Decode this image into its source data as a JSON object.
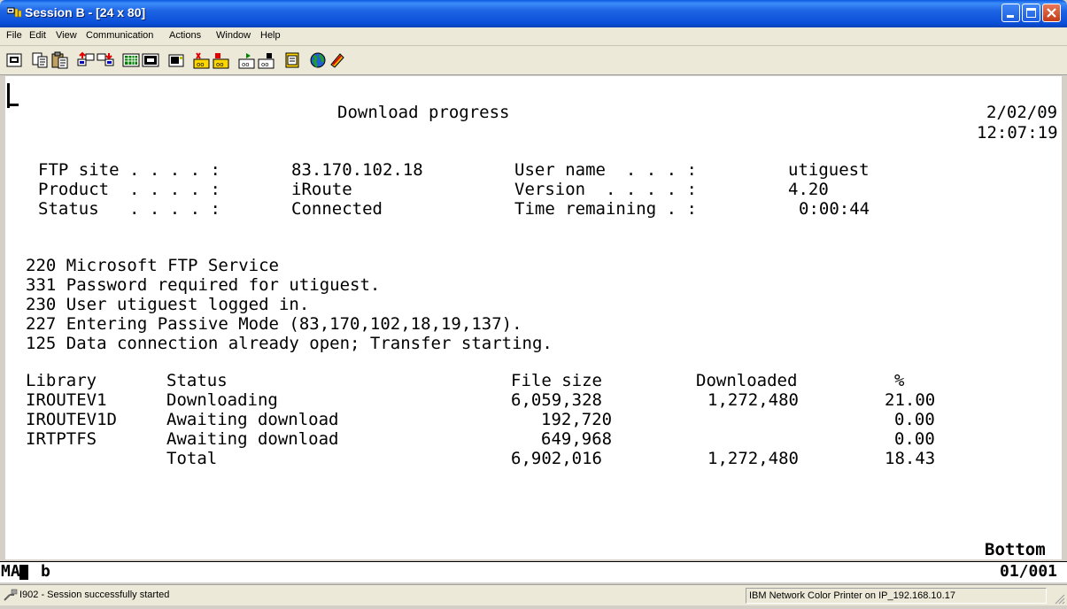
{
  "window": {
    "title": "Session B - [24 x 80]",
    "controls": {
      "minimize": "minimize",
      "maximize": "maximize",
      "close": "close"
    }
  },
  "menu": [
    "File",
    "Edit",
    "View",
    "Communication",
    "Actions",
    "Window",
    "Help"
  ],
  "toolbar": {
    "buttons": [
      "print-screen-icon",
      "copy-icon",
      "paste-icon",
      "send-file-icon",
      "receive-file-icon",
      "display-keypad-icon",
      "macro-icon",
      "clipboard-icon",
      "play-macro-icon",
      "record-macro-icon",
      "start-macro-icon",
      "stop-macro-icon",
      "notepad-icon",
      "globe-icon",
      "help-icon"
    ]
  },
  "terminal": {
    "screen_title": "Download progress",
    "date": "2/02/09",
    "time": "12:07:19",
    "fields": {
      "ftp_site_label": "FTP site . . . . :",
      "ftp_site_value": "83.170.102.18",
      "user_name_label": "User name  . . . :",
      "user_name_value": "utiguest",
      "product_label": "Product  . . . . :",
      "product_value": "iRoute",
      "version_label": "Version  . . . . :",
      "version_value": "4.20",
      "status_label": "Status   . . . . :",
      "status_value": "Connected",
      "time_remaining_label": "Time remaining . :",
      "time_remaining_value": "0:00:44"
    },
    "log": [
      "220 Microsoft FTP Service",
      "331 Password required for utiguest.",
      "230 User utiguest logged in.",
      "227 Entering Passive Mode (83,170,102,18,19,137).",
      "125 Data connection already open; Transfer starting."
    ],
    "table": {
      "headers": {
        "library": "Library",
        "status": "Status",
        "file_size": "File size",
        "downloaded": "Downloaded",
        "percent": "%"
      },
      "rows": [
        {
          "library": "IROUTEV1",
          "status": "Downloading",
          "file_size": "6,059,328",
          "downloaded": "1,272,480",
          "percent": "21.00"
        },
        {
          "library": "IROUTEV1D",
          "status": "Awaiting download",
          "file_size": "192,720",
          "downloaded": "",
          "percent": "0.00"
        },
        {
          "library": "IRTPTFS",
          "status": "Awaiting download",
          "file_size": "649,968",
          "downloaded": "",
          "percent": "0.00"
        }
      ],
      "total": {
        "label": "Total",
        "file_size": "6,902,016",
        "downloaded": "1,272,480",
        "percent": "18.43"
      }
    },
    "bottom_indicator": "Bottom"
  },
  "oia": {
    "mode": "MA",
    "session_letter": "b",
    "cursor_position": "01/001"
  },
  "statusbar": {
    "message": "I902 - Session successfully started",
    "printer": "IBM Network Color Printer on IP_192.168.10.17"
  }
}
